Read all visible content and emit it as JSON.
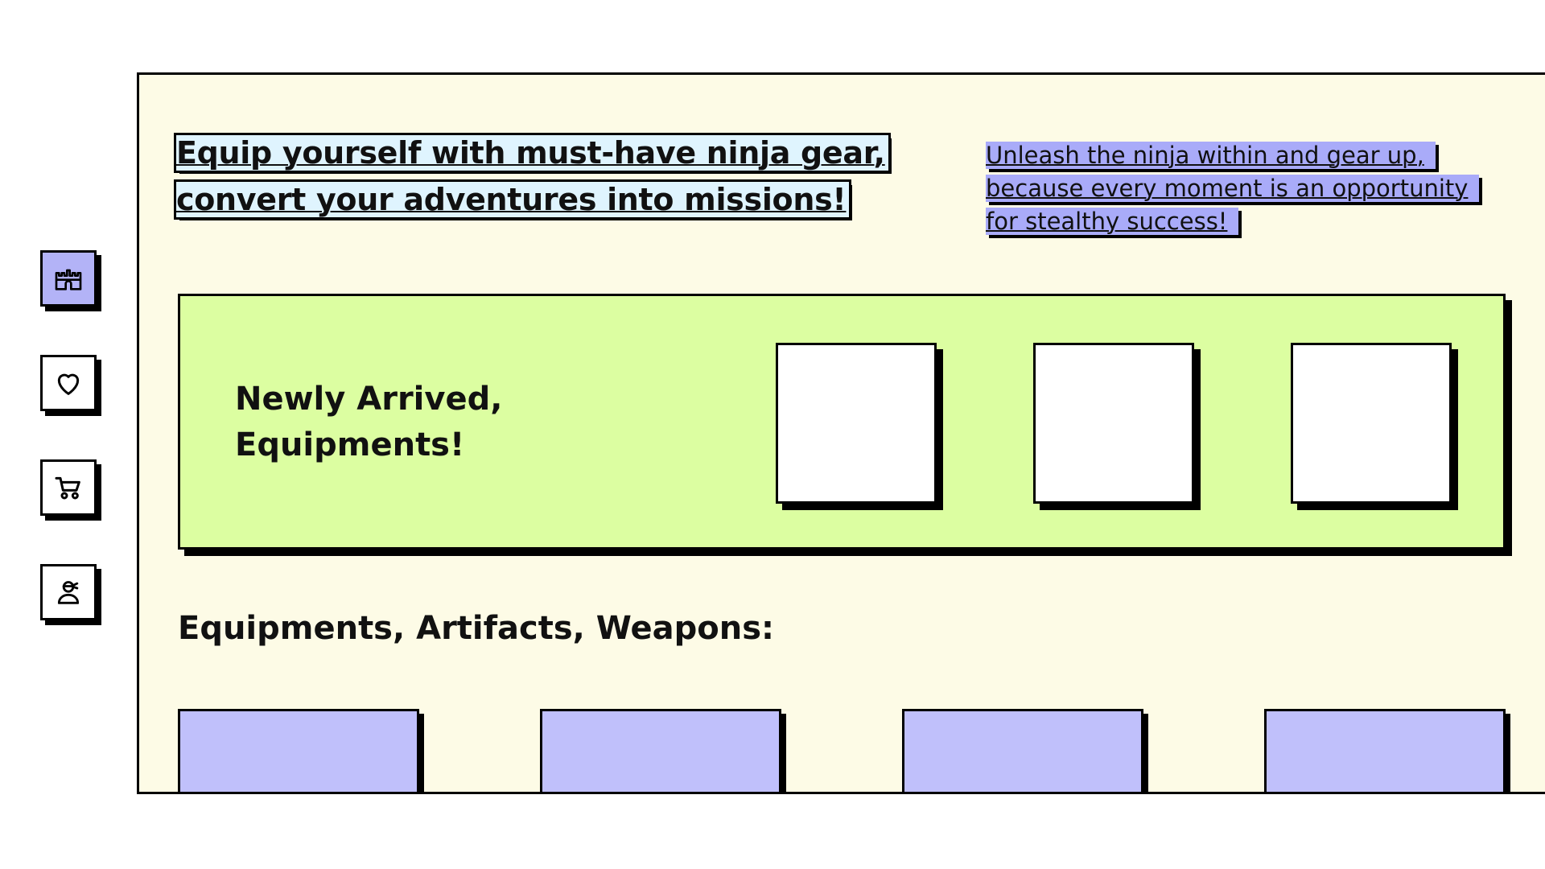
{
  "sidebar": {
    "items": [
      {
        "name": "castle",
        "icon": "castle-icon",
        "active": true
      },
      {
        "name": "favorites",
        "icon": "heart-icon",
        "active": false
      },
      {
        "name": "cart",
        "icon": "cart-icon",
        "active": false
      },
      {
        "name": "profile",
        "icon": "ninja-icon",
        "active": false
      }
    ]
  },
  "hero": {
    "headline_line1": "Equip yourself with must-have ninja gear,",
    "headline_line2": "convert your adventures into missions!",
    "tagline_line1": "Unleash the ninja within and gear up,",
    "tagline_line2": "because every moment is an opportunity",
    "tagline_line3": "for stealthy success!"
  },
  "arrivals": {
    "title_line1": "Newly Arrived,",
    "title_line2": "Equipments!",
    "card_count": 3
  },
  "catalog": {
    "title": "Equipments, Artifacts, Weapons:",
    "card_count": 4
  },
  "colors": {
    "page": "#fdfbe6",
    "sidebar_active": "#b3b3f7",
    "headline_highlight": "#dff4fe",
    "tagline_highlight": "#a9abf9",
    "arrivals_panel": "#dcfea1",
    "product_card": "#c0c0fb"
  }
}
